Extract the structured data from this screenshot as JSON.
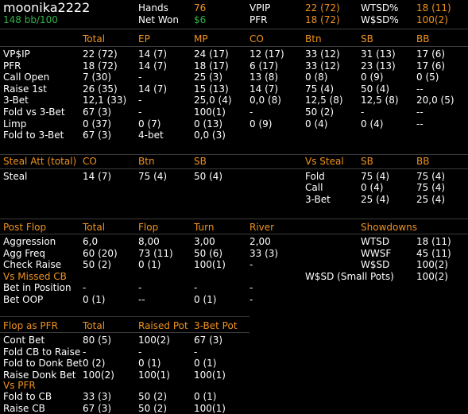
{
  "header": {
    "player": "moonika2222",
    "winrate": "148 bb/100",
    "stats": [
      {
        "label": "Hands",
        "value": "76"
      },
      {
        "label": "Net Won",
        "value": "$6"
      },
      {
        "label": "VPIP",
        "value": "22 (72)"
      },
      {
        "label": "PFR",
        "value": "18 (72)"
      },
      {
        "label": "WTSD%",
        "value": "18 (11)"
      },
      {
        "label": "W$SD%",
        "value": "100(2)"
      }
    ]
  },
  "preflop": {
    "columns": [
      "Total",
      "EP",
      "MP",
      "CO",
      "Btn",
      "SB",
      "BB"
    ],
    "rows": [
      {
        "label": "VP$IP",
        "cells": [
          "22 (72)",
          "14 (7)",
          "24 (17)",
          "12 (17)",
          "33 (12)",
          "31 (13)",
          "17 (6)"
        ]
      },
      {
        "label": "PFR",
        "cells": [
          "18 (72)",
          "14 (7)",
          "18 (17)",
          "6 (17)",
          "33 (12)",
          "23 (13)",
          "17 (6)"
        ]
      },
      {
        "label": "Call Open",
        "cells": [
          "7 (30)",
          "-",
          "25 (3)",
          "13 (8)",
          "0 (8)",
          "0 (9)",
          "0 (5)"
        ]
      },
      {
        "label": "Raise 1st",
        "cells": [
          "26 (35)",
          "14 (7)",
          "15 (13)",
          "14 (7)",
          "75 (4)",
          "50 (4)",
          "--"
        ]
      },
      {
        "label": "3-Bet",
        "cells": [
          "12,1 (33)",
          "-",
          "25,0 (4)",
          "0,0 (8)",
          "12,5 (8)",
          "12,5 (8)",
          "20,0 (5)"
        ]
      },
      {
        "label": "Fold vs 3-Bet",
        "cells": [
          "67 (3)",
          "-",
          "100(1)",
          "-",
          "50 (2)",
          "-",
          "--"
        ]
      },
      {
        "label": "Limp",
        "cells": [
          "0 (37)",
          "0 (7)",
          "0 (13)",
          "0 (9)",
          "0 (4)",
          "0 (4)",
          "--"
        ]
      },
      {
        "label": "Fold to 3-Bet",
        "cells": [
          "67 (3)",
          "4-bet",
          "0,0 (3)",
          "",
          "",
          "",
          ""
        ]
      }
    ]
  },
  "steal": {
    "title": "Steal Att (total)",
    "columns": [
      "CO",
      "Btn",
      "SB"
    ],
    "row": {
      "label": "Steal",
      "cells": [
        "14 (7)",
        "75 (4)",
        "50 (4)"
      ]
    },
    "vs": {
      "title": "Vs Steal",
      "columns": [
        "SB",
        "BB"
      ],
      "rows": [
        {
          "label": "Fold",
          "cells": [
            "75 (4)",
            "75 (4)"
          ]
        },
        {
          "label": "Call",
          "cells": [
            "0 (4)",
            "75 (4)"
          ]
        },
        {
          "label": "3-Bet",
          "cells": [
            "25 (4)",
            "25 (4)"
          ]
        }
      ]
    }
  },
  "postflop": {
    "title": "Post Flop",
    "columns": [
      "Total",
      "Flop",
      "Turn",
      "River"
    ],
    "rows": [
      {
        "label": "Aggression",
        "cells": [
          "6,0",
          "8,00",
          "3,00",
          "2,00"
        ]
      },
      {
        "label": "Agg Freq",
        "cells": [
          "60 (20)",
          "73 (11)",
          "50 (6)",
          "33 (3)"
        ]
      },
      {
        "label": "Check Raise",
        "cells": [
          "50 (2)",
          "0 (1)",
          "100(1)",
          "-"
        ]
      }
    ],
    "missed_title": "Vs Missed CB",
    "missed_rows": [
      {
        "label": "Bet in Position",
        "cells": [
          "-",
          "-",
          "-",
          "-"
        ]
      },
      {
        "label": "Bet OOP",
        "cells": [
          "0 (1)",
          "--",
          "0 (1)",
          "-"
        ]
      }
    ]
  },
  "showdowns": {
    "title": "Showdowns",
    "rows": [
      {
        "label": "WTSD",
        "value": "18 (11)"
      },
      {
        "label": "WWSF",
        "value": "45 (11)"
      },
      {
        "label": "W$SD",
        "value": "100(2)"
      },
      {
        "label": "W$SD (Small Pots)",
        "value": "100(2)"
      }
    ]
  },
  "pfr": {
    "title": "Flop as PFR",
    "columns": [
      "Total",
      "Raised Pot",
      "3-Bet Pot"
    ],
    "rows": [
      {
        "label": "Cont Bet",
        "cells": [
          "80 (5)",
          "100(2)",
          "67 (3)"
        ]
      },
      {
        "label": "Fold CB to Raise",
        "cells": [
          "-",
          "-",
          "-"
        ]
      },
      {
        "label": "Fold to Donk Bet",
        "cells": [
          "0 (2)",
          "0 (1)",
          "0 (1)"
        ]
      },
      {
        "label": "Raise Donk Bet",
        "cells": [
          "100(2)",
          "100(1)",
          "100(1)"
        ]
      }
    ],
    "vs_title": "Vs PFR",
    "vs_rows": [
      {
        "label": "Fold to CB",
        "cells": [
          "33 (3)",
          "50 (2)",
          "0 (1)"
        ]
      },
      {
        "label": "Raise CB",
        "cells": [
          "67 (3)",
          "50 (2)",
          "100(1)"
        ]
      }
    ]
  }
}
